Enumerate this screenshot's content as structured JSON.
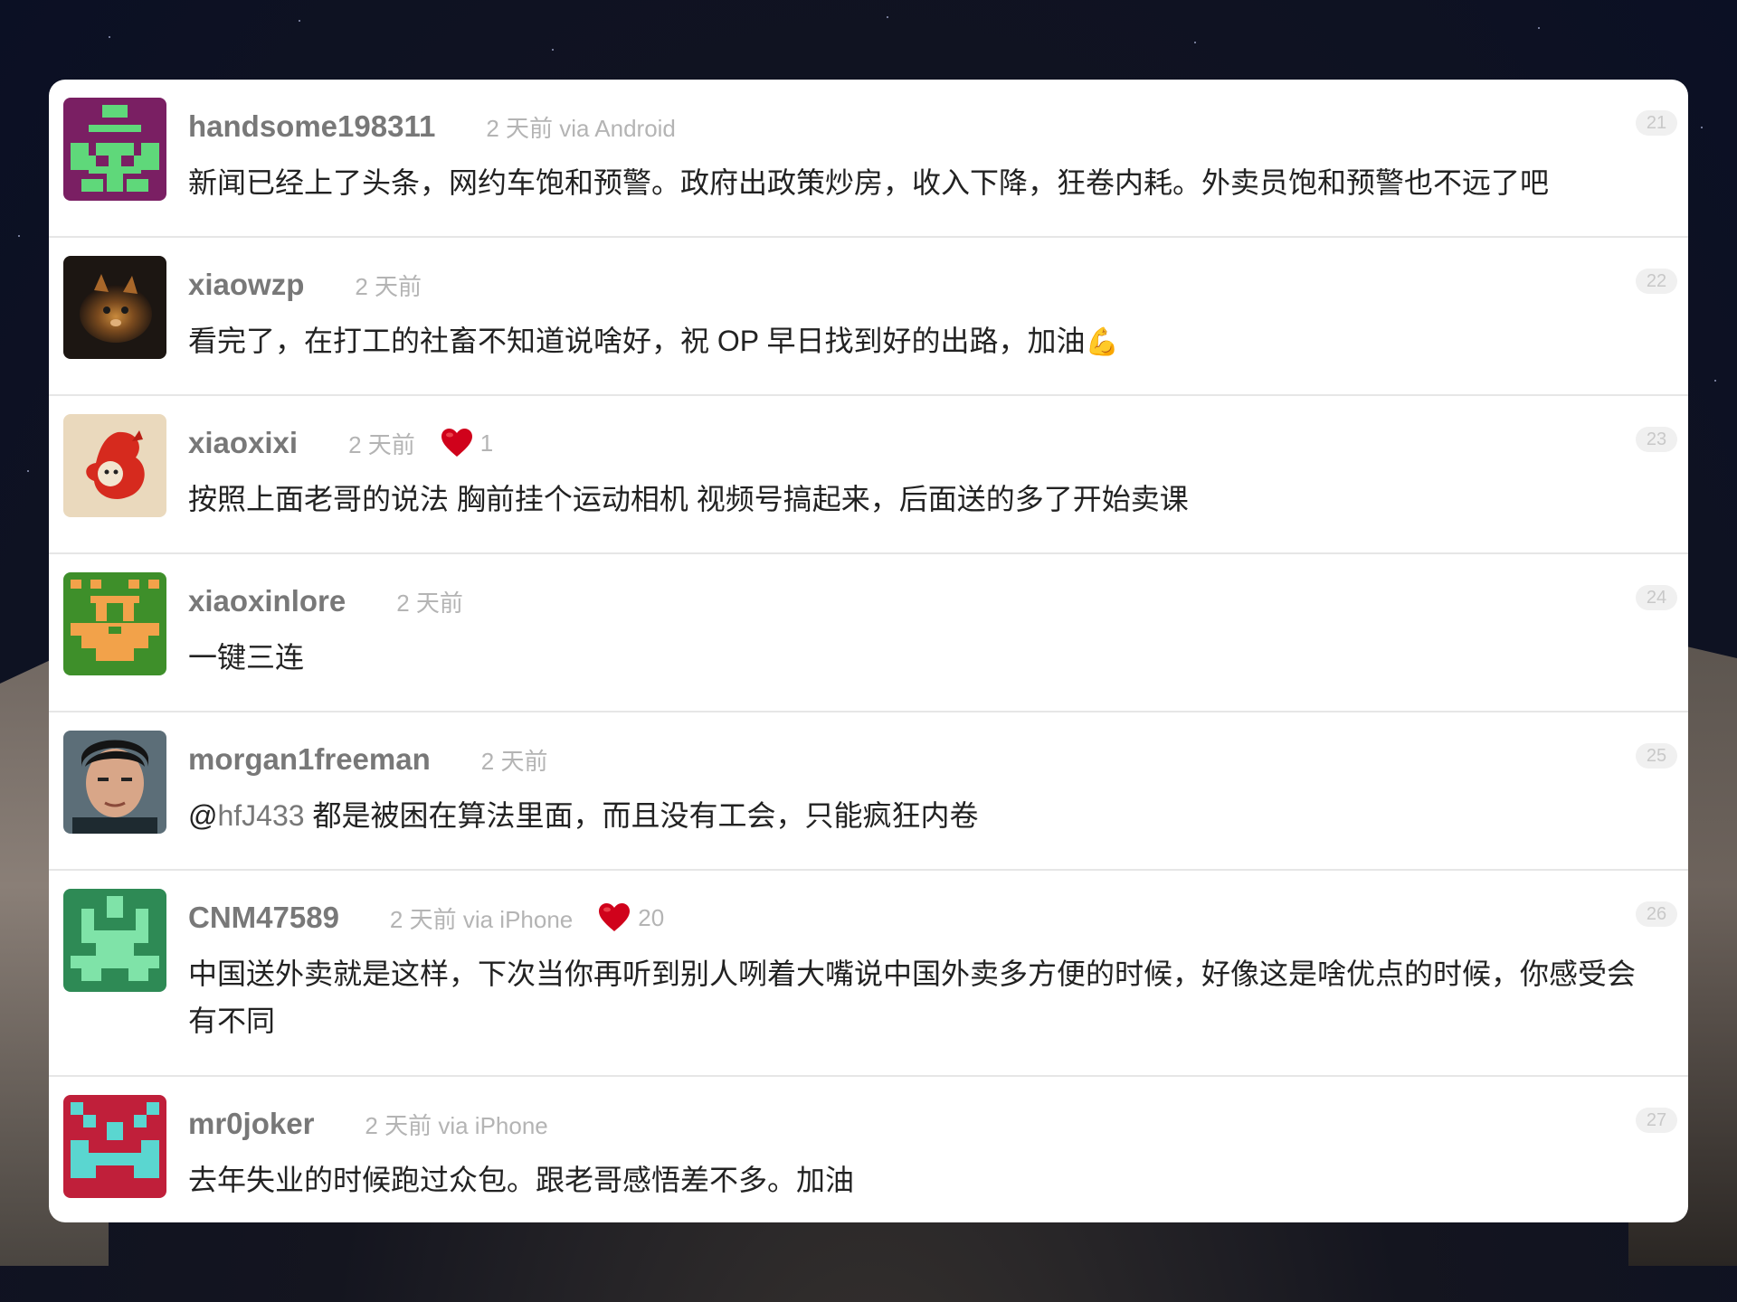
{
  "comments": [
    {
      "username": "handsome198311",
      "time": "2 天前 via Android",
      "likes": null,
      "text": "新闻已经上了头条，网约车饱和预警。政府出政策炒房，收入下降，狂卷内耗。外卖员饱和预警也不远了吧",
      "floor": "21",
      "avatar": "pixel-avatar-purple-green"
    },
    {
      "username": "xiaowzp",
      "time": "2 天前",
      "likes": null,
      "text": "看完了，在打工的社畜不知道说啥好，祝 OP 早日找到好的出路，加油",
      "emoji": "💪",
      "floor": "22",
      "avatar": "photo-avatar-cat"
    },
    {
      "username": "xiaoxixi",
      "time": "2 天前",
      "likes": "1",
      "text": "按照上面老哥的说法 胸前挂个运动相机 视频号搞起来，后面送的多了开始卖课",
      "floor": "23",
      "avatar": "photo-avatar-red-figure"
    },
    {
      "username": "xiaoxinlore",
      "time": "2 天前",
      "likes": null,
      "text": "一键三连",
      "floor": "24",
      "avatar": "pixel-avatar-green-orange"
    },
    {
      "username": "morgan1freeman",
      "time": "2 天前",
      "likes": null,
      "mention_prefix": "@",
      "mention": "hfJ433",
      "text": " 都是被困在算法里面，而且没有工会，只能疯狂内卷",
      "floor": "25",
      "avatar": "photo-avatar-man"
    },
    {
      "username": "CNM47589",
      "time": "2 天前 via iPhone",
      "likes": "20",
      "text": "中国送外卖就是这样，下次当你再听到别人咧着大嘴说中国外卖多方便的时候，好像这是啥优点的时候，你感受会有不同",
      "floor": "26",
      "avatar": "pixel-avatar-green-mint"
    },
    {
      "username": "mr0joker",
      "time": "2 天前 via iPhone",
      "likes": null,
      "text": "去年失业的时候跑过众包。跟老哥感悟差不多。加油",
      "floor": "27",
      "avatar": "pixel-avatar-red-cyan"
    }
  ],
  "colors": {
    "username": "#787878",
    "meta": "#b4b4b4",
    "text": "#222222",
    "heart": "#d0021b"
  }
}
